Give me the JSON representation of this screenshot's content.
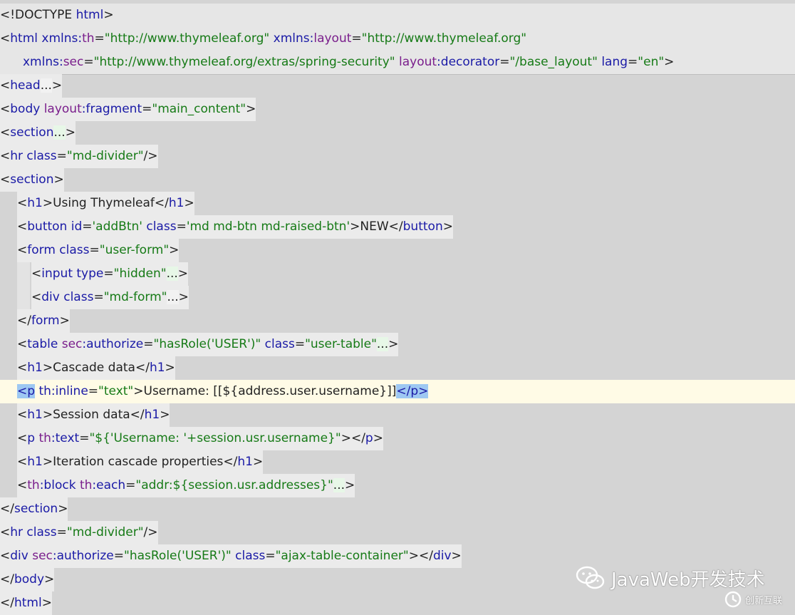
{
  "editor": {
    "lines": [
      {
        "style": "band",
        "indent": 0,
        "tokens": [
          [
            "pun",
            "<!DOCTYPE "
          ],
          [
            "tag",
            "html"
          ],
          [
            "pun",
            ">"
          ]
        ]
      },
      {
        "style": "band",
        "indent": 0,
        "tokens": [
          [
            "pun",
            "<"
          ],
          [
            "tag",
            "html "
          ],
          [
            "attr",
            "xmlns:"
          ],
          [
            "ns",
            "th"
          ],
          [
            "pun",
            "="
          ],
          [
            "str",
            "\"http://www.thymeleaf.org\" "
          ],
          [
            "attr",
            "xmlns:"
          ],
          [
            "ns",
            "layout"
          ],
          [
            "pun",
            "="
          ],
          [
            "str",
            "\"http://www.thymeleaf.org\""
          ]
        ]
      },
      {
        "style": "band",
        "indent": 0,
        "cont": true,
        "tokens": [
          [
            "attr",
            "xmlns:"
          ],
          [
            "ns",
            "sec"
          ],
          [
            "pun",
            "="
          ],
          [
            "str",
            "\"http://www.thymeleaf.org/extras/spring-security\" "
          ],
          [
            "ns",
            "layout"
          ],
          [
            "attr",
            ":decorator"
          ],
          [
            "pun",
            "="
          ],
          [
            "str",
            "\"/base_layout\" "
          ],
          [
            "attr",
            "lang"
          ],
          [
            "pun",
            "="
          ],
          [
            "str",
            "\"en\""
          ],
          [
            "pun",
            ">"
          ]
        ]
      },
      {
        "style": "hl",
        "indent": 0,
        "tokens": [
          [
            "pun",
            "<"
          ],
          [
            "tag",
            "head"
          ],
          [
            "fold",
            "..."
          ],
          [
            "pun",
            ">"
          ]
        ]
      },
      {
        "style": "hl",
        "indent": 0,
        "tokens": [
          [
            "pun",
            "<"
          ],
          [
            "tag",
            "body "
          ],
          [
            "ns",
            "layout"
          ],
          [
            "attr",
            ":fragment"
          ],
          [
            "pun",
            "="
          ],
          [
            "str",
            "\"main_content\""
          ],
          [
            "pun",
            ">"
          ]
        ]
      },
      {
        "style": "hl",
        "indent": 0,
        "tokens": [
          [
            "pun",
            "<"
          ],
          [
            "tag",
            "section"
          ],
          [
            "foldg",
            "..."
          ],
          [
            "pun",
            ">"
          ]
        ]
      },
      {
        "style": "hl",
        "indent": 0,
        "tokens": [
          [
            "pun",
            "<"
          ],
          [
            "tag",
            "hr "
          ],
          [
            "attr",
            "class"
          ],
          [
            "pun",
            "="
          ],
          [
            "str",
            "\"md-divider\""
          ],
          [
            "pun",
            "/>"
          ]
        ]
      },
      {
        "style": "hl",
        "indent": 0,
        "tokens": [
          [
            "pun",
            "<"
          ],
          [
            "tag",
            "section"
          ],
          [
            "pun",
            ">"
          ]
        ]
      },
      {
        "style": "hl",
        "indent": 1,
        "tokens": [
          [
            "pun",
            "<"
          ],
          [
            "tag",
            "h1"
          ],
          [
            "pun",
            ">"
          ],
          [
            "text",
            "Using Thymeleaf"
          ],
          [
            "pun",
            "</"
          ],
          [
            "tag",
            "h1"
          ],
          [
            "pun",
            ">"
          ]
        ]
      },
      {
        "style": "hl",
        "indent": 1,
        "tokens": [
          [
            "pun",
            "<"
          ],
          [
            "tag",
            "button "
          ],
          [
            "attr",
            "id"
          ],
          [
            "pun",
            "="
          ],
          [
            "str",
            "'addBtn' "
          ],
          [
            "attr",
            "class"
          ],
          [
            "pun",
            "="
          ],
          [
            "str",
            "'md md-btn md-raised-btn'"
          ],
          [
            "pun",
            ">"
          ],
          [
            "text",
            "NEW"
          ],
          [
            "pun",
            "</"
          ],
          [
            "tag",
            "button"
          ],
          [
            "pun",
            ">"
          ]
        ]
      },
      {
        "style": "hl",
        "indent": 1,
        "tokens": [
          [
            "pun",
            "<"
          ],
          [
            "tag",
            "form "
          ],
          [
            "attr",
            "class"
          ],
          [
            "pun",
            "="
          ],
          [
            "str",
            "\"user-form\""
          ],
          [
            "pun",
            ">"
          ]
        ]
      },
      {
        "style": "hl",
        "indent": 2,
        "tokens": [
          [
            "pun",
            "<"
          ],
          [
            "tag",
            "input "
          ],
          [
            "attr",
            "type"
          ],
          [
            "pun",
            "="
          ],
          [
            "str",
            "\"hidden\""
          ],
          [
            "foldg",
            "..."
          ],
          [
            "pun",
            ">"
          ]
        ]
      },
      {
        "style": "hl",
        "indent": 2,
        "tokens": [
          [
            "pun",
            "<"
          ],
          [
            "tag",
            "div "
          ],
          [
            "attr",
            "class"
          ],
          [
            "pun",
            "="
          ],
          [
            "str",
            "\"md-form\""
          ],
          [
            "fold",
            "..."
          ],
          [
            "pun",
            ">"
          ]
        ]
      },
      {
        "style": "hl",
        "indent": 1,
        "tokens": [
          [
            "pun",
            "</"
          ],
          [
            "tag",
            "form"
          ],
          [
            "pun",
            ">"
          ]
        ]
      },
      {
        "style": "hl",
        "indent": 1,
        "tokens": [
          [
            "pun",
            "<"
          ],
          [
            "tag",
            "table "
          ],
          [
            "ns",
            "sec"
          ],
          [
            "attr",
            ":authorize"
          ],
          [
            "pun",
            "="
          ],
          [
            "str",
            "\"hasRole('USER')\" "
          ],
          [
            "attr",
            "class"
          ],
          [
            "pun",
            "="
          ],
          [
            "str",
            "\"user-table\""
          ],
          [
            "foldg",
            "..."
          ],
          [
            "pun",
            ">"
          ]
        ]
      },
      {
        "style": "hl",
        "indent": 1,
        "tokens": [
          [
            "pun",
            "<"
          ],
          [
            "tag",
            "h1"
          ],
          [
            "pun",
            ">"
          ],
          [
            "text",
            "Cascade data"
          ],
          [
            "pun",
            "</"
          ],
          [
            "tag",
            "h1"
          ],
          [
            "pun",
            ">"
          ]
        ]
      },
      {
        "style": "current",
        "indent": 1,
        "tokens": [
          [
            "matchtag",
            "<p"
          ],
          [
            "attr",
            " th:inline"
          ],
          [
            "pun",
            "="
          ],
          [
            "str",
            "\"text\""
          ],
          [
            "pun",
            ">"
          ],
          [
            "text",
            "Username: [[${address.user.username}]]"
          ],
          [
            "matchtag",
            "</p>"
          ]
        ]
      },
      {
        "style": "hl",
        "indent": 1,
        "tokens": [
          [
            "pun",
            "<"
          ],
          [
            "tag",
            "h1"
          ],
          [
            "pun",
            ">"
          ],
          [
            "text",
            "Session data"
          ],
          [
            "pun",
            "</"
          ],
          [
            "tag",
            "h1"
          ],
          [
            "pun",
            ">"
          ]
        ]
      },
      {
        "style": "hl",
        "indent": 1,
        "tokens": [
          [
            "pun",
            "<"
          ],
          [
            "tag",
            "p "
          ],
          [
            "ns",
            "th"
          ],
          [
            "attr",
            ":text"
          ],
          [
            "pun",
            "="
          ],
          [
            "str",
            "\"${'Username: '+session.usr.username}\""
          ],
          [
            "pun",
            "></"
          ],
          [
            "tag",
            "p"
          ],
          [
            "pun",
            ">"
          ]
        ]
      },
      {
        "style": "hl",
        "indent": 1,
        "tokens": [
          [
            "pun",
            "<"
          ],
          [
            "tag",
            "h1"
          ],
          [
            "pun",
            ">"
          ],
          [
            "text",
            "Iteration cascade properties"
          ],
          [
            "pun",
            "</"
          ],
          [
            "tag",
            "h1"
          ],
          [
            "pun",
            ">"
          ]
        ]
      },
      {
        "style": "hl",
        "indent": 1,
        "tokens": [
          [
            "pun",
            "<"
          ],
          [
            "ns",
            "th"
          ],
          [
            "tag",
            ":block "
          ],
          [
            "ns",
            "th"
          ],
          [
            "attr",
            ":each"
          ],
          [
            "pun",
            "="
          ],
          [
            "str",
            "\"addr:${session.usr.addresses}\""
          ],
          [
            "foldg",
            "..."
          ],
          [
            "pun",
            ">"
          ]
        ]
      },
      {
        "style": "hl",
        "indent": 0,
        "tokens": [
          [
            "pun",
            "</"
          ],
          [
            "tag",
            "section"
          ],
          [
            "pun",
            ">"
          ]
        ]
      },
      {
        "style": "hl",
        "indent": 0,
        "tokens": [
          [
            "pun",
            "<"
          ],
          [
            "tag",
            "hr "
          ],
          [
            "attr",
            "class"
          ],
          [
            "pun",
            "="
          ],
          [
            "str",
            "\"md-divider\""
          ],
          [
            "pun",
            "/>"
          ]
        ]
      },
      {
        "style": "hl",
        "indent": 0,
        "tokens": [
          [
            "pun",
            "<"
          ],
          [
            "tag",
            "div "
          ],
          [
            "ns",
            "sec"
          ],
          [
            "attr",
            ":authorize"
          ],
          [
            "pun",
            "="
          ],
          [
            "str",
            "\"hasRole('USER')\" "
          ],
          [
            "attr",
            "class"
          ],
          [
            "pun",
            "="
          ],
          [
            "str",
            "\"ajax-table-container\""
          ],
          [
            "pun",
            "></"
          ],
          [
            "tag",
            "div"
          ],
          [
            "pun",
            ">"
          ]
        ]
      },
      {
        "style": "hl",
        "indent": 0,
        "tokens": [
          [
            "pun",
            "</"
          ],
          [
            "tag",
            "body"
          ],
          [
            "pun",
            ">"
          ]
        ]
      },
      {
        "style": "hl",
        "indent": 0,
        "tokens": [
          [
            "pun",
            "</"
          ],
          [
            "tag",
            "html"
          ],
          [
            "pun",
            ">"
          ]
        ]
      }
    ]
  },
  "watermark": {
    "text": "JavaWeb开发技术",
    "icon": "wechat-icon"
  },
  "brand": {
    "text": "创新互联",
    "icon": "brand-logo-icon"
  },
  "colors": {
    "tag": "#1a1aa6",
    "namespace": "#7a1e8c",
    "string": "#167a16",
    "current_line": "#fffbe6",
    "bracket_match": "#9ec8f2"
  }
}
